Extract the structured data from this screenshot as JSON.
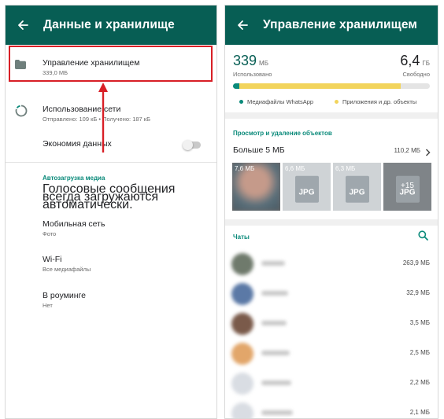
{
  "left": {
    "appbar": {
      "back_icon": "arrow-left-icon",
      "title": "Данные и хранилище"
    },
    "storage_manage": {
      "title": "Управление хранилищем",
      "subtitle": "339,0 МБ",
      "icon": "folder-icon"
    },
    "network_usage": {
      "title": "Использование сети",
      "subtitle": "Отправлено: 109 кБ • Получено: 187 кБ",
      "icon": "data-usage-icon"
    },
    "data_saver": {
      "title": "Экономия данных",
      "toggle_on": false
    },
    "autodownload": {
      "header": "Автозагрузка медиа",
      "voice_note": "Голосовые сообщения всегда загружаются автоматически.",
      "items": [
        {
          "title": "Мобильная сеть",
          "subtitle": "Фото"
        },
        {
          "title": "Wi-Fi",
          "subtitle": "Все медиафайлы"
        },
        {
          "title": "В роуминге",
          "subtitle": "Нет"
        }
      ]
    },
    "annotation": {
      "highlight_color": "#d81f26",
      "arrow": "red-arrow-up"
    }
  },
  "right": {
    "appbar": {
      "back_icon": "arrow-left-icon",
      "title": "Управление хранилищем"
    },
    "used": {
      "value": "339",
      "unit": "МБ",
      "label": "Использовано"
    },
    "free": {
      "value": "6,4",
      "unit": "ГБ",
      "label": "Свободно"
    },
    "usage_bar": {
      "whatsapp_fraction": 0.03,
      "apps_fraction": 0.82,
      "whatsapp_color": "#0a8a7a",
      "apps_color": "#f2d45c"
    },
    "legend": [
      {
        "label": "Медиафайлы WhatsApp",
        "color": "#0a8a7a"
      },
      {
        "label": "Приложения и др. объекты",
        "color": "#f2d45c"
      }
    ],
    "review": {
      "header": "Просмотр и удаление объектов",
      "larger_label": "Больше 5 МБ",
      "larger_size": "110,2 МБ",
      "thumbs": [
        {
          "size": "7,6 МБ",
          "ext": ""
        },
        {
          "size": "6,6 МБ",
          "ext": "JPG"
        },
        {
          "size": "6,3 МБ",
          "ext": "JPG"
        },
        {
          "size": "",
          "ext": "JPG",
          "more": "+15"
        }
      ]
    },
    "chats": {
      "header": "Чаты",
      "search_icon": "search-icon",
      "items": [
        {
          "size": "263,9 МБ",
          "avatar_color": "#6f7a6c"
        },
        {
          "size": "32,9 МБ",
          "avatar_color": "#5b79a6"
        },
        {
          "size": "3,5 МБ",
          "avatar_color": "#7a5a4a"
        },
        {
          "size": "2,5 МБ",
          "avatar_color": "#e2a66a"
        },
        {
          "size": "2,2 МБ",
          "avatar_color": "#d9dde3"
        },
        {
          "size": "2,1 МБ",
          "avatar_color": "#d9dde3"
        }
      ]
    }
  },
  "colors": {
    "appbar": "#075e54",
    "accent": "#0a8a7a",
    "annotation_red": "#d81f26"
  }
}
